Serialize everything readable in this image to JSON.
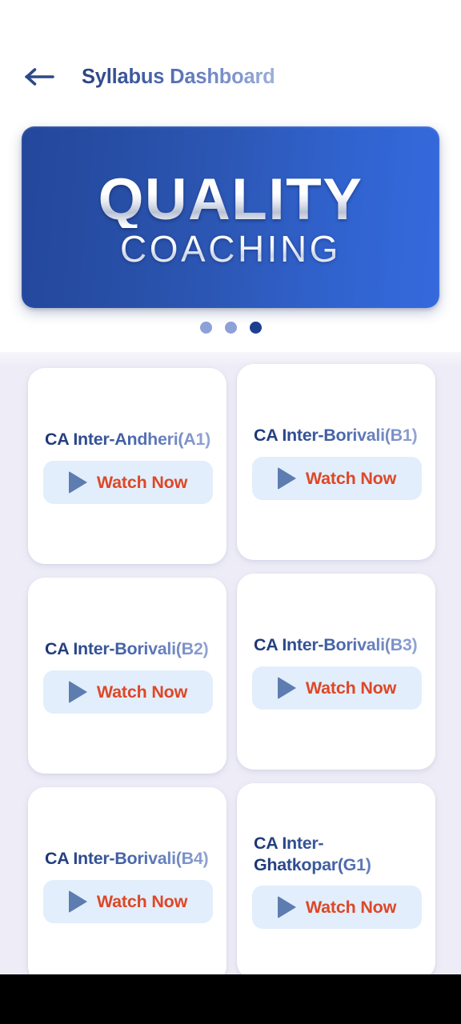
{
  "header": {
    "back_icon": "arrow-left-icon",
    "title": "Syllabus Dashboard"
  },
  "banner": {
    "title_main": "QUALITY",
    "title_sub": "COACHING",
    "bg_color_start": "#23479b",
    "bg_color_end": "#3569dd"
  },
  "carousel": {
    "dots": [
      {
        "active": false
      },
      {
        "active": false
      },
      {
        "active": true
      }
    ],
    "active_index": 2,
    "dot_color": "#8da0d8",
    "dot_active_color": "#1d3f8f"
  },
  "grid": {
    "background": "#eeedf7",
    "cards": [
      {
        "title": "CA Inter-Andheri(A1)",
        "button_label": "Watch Now",
        "icon": "play-icon",
        "two_line": false
      },
      {
        "title": "CA Inter-Borivali(B1)",
        "button_label": "Watch Now",
        "icon": "play-icon",
        "two_line": false
      },
      {
        "title": "CA Inter-Borivali(B2)",
        "button_label": "Watch Now",
        "icon": "play-icon",
        "two_line": false
      },
      {
        "title": "CA Inter-Borivali(B3)",
        "button_label": "Watch Now",
        "icon": "play-icon",
        "two_line": false
      },
      {
        "title": "CA Inter-Borivali(B4)",
        "button_label": "Watch Now",
        "icon": "play-icon",
        "two_line": false
      },
      {
        "title": "CA Inter-Ghatkopar(G1)",
        "button_label": "Watch Now",
        "icon": "play-icon",
        "two_line": true
      }
    ],
    "button_bg": "#e2eefb",
    "button_text_color": "#de4727",
    "play_color": "#5d7cb0",
    "title_color_start": "#1d3673",
    "title_color_end": "#9aaad6"
  }
}
